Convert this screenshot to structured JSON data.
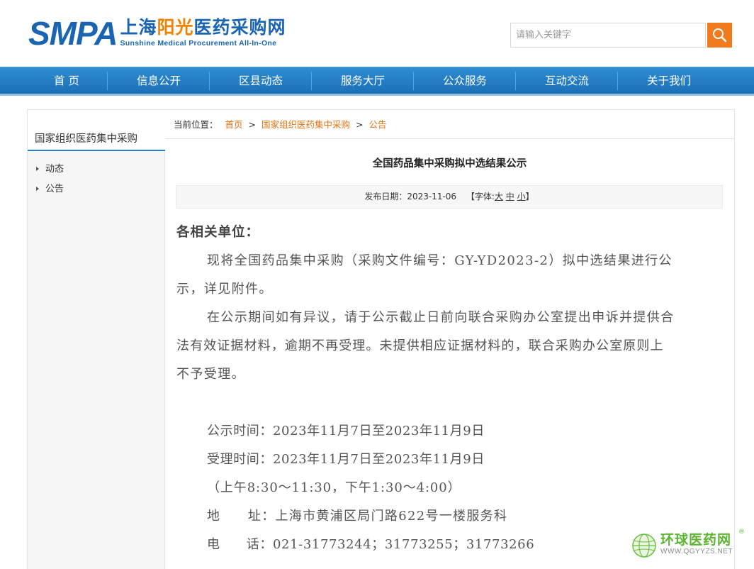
{
  "header": {
    "logo_smpa": "SMPA",
    "logo_cn_part1": "上海",
    "logo_cn_part2": "阳光",
    "logo_cn_part3": "医药采购网",
    "logo_en": "Sunshine Medical Procurement All-In-One",
    "search_placeholder": "请输入关键字",
    "brand_blue": "#1a64b4",
    "brand_orange": "#f07a1e"
  },
  "nav": {
    "items": [
      "首 页",
      "信息公开",
      "区县动态",
      "服务大厅",
      "公众服务",
      "互动交流",
      "关于我们"
    ]
  },
  "sidebar": {
    "title": "国家组织医药集中采购",
    "items": [
      "动态",
      "公告"
    ]
  },
  "breadcrumb": {
    "prefix": "当前位置：",
    "items": [
      "首页",
      "国家组织医药集中采购",
      "公告"
    ],
    "separator": ">"
  },
  "article": {
    "title": "全国药品集中采购拟中选结果公示",
    "date_label": "发布日期：",
    "date": "2023-11-06",
    "font_prefix": "【字体:",
    "font_large": "大",
    "font_medium": "中",
    "font_small": "小",
    "font_suffix": "】",
    "greeting": "各相关单位：",
    "lines": [
      "现将全国药品集中采购（采购文件编号：GY-YD2023-2）拟中选结果进行公",
      "示，详见附件。",
      "在公示期间如有异议，请于公示截止日前向联合采购办公室提出申诉并提供合",
      "法有效证据材料，逾期不再受理。未提供相应证据材料的，联合采购办公室原则上",
      "不予受理。",
      "公示时间：2023年11月7日至2023年11月9日",
      "受理时间：2023年11月7日至2023年11月9日",
      "（上午8:30～11:30，下午1:30～4:00）",
      "地　　址：上海市黄浦区局门路622号一楼服务科",
      "电　　话：021-31773244；31773255；31773266"
    ]
  },
  "watermark": {
    "name": "环球医药网",
    "url": "WWW.QGYYZS.NET",
    "reg": "®"
  }
}
